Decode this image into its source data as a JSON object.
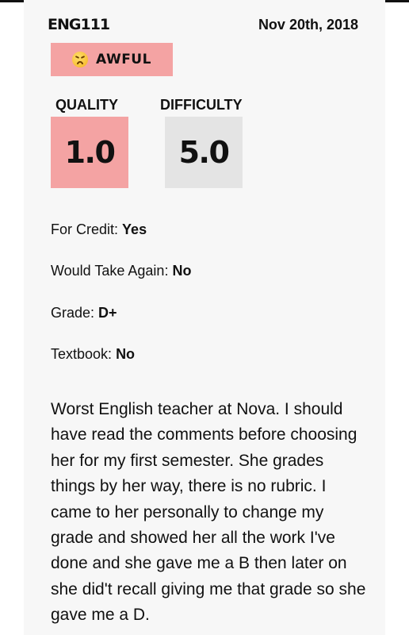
{
  "course": "ENG111",
  "date": "Nov 20th, 2018",
  "rating_tag": {
    "label": "AWFUL",
    "icon": "confounded-face-emoji",
    "color": "#f4a3a3"
  },
  "quality": {
    "label": "QUALITY",
    "value": "1.0",
    "color": "#f4a3a3"
  },
  "difficulty": {
    "label": "DIFFICULTY",
    "value": "5.0",
    "color": "#e4e4e4"
  },
  "details": [
    {
      "label": "For Credit:",
      "value": "Yes"
    },
    {
      "label": "Would Take Again:",
      "value": "No"
    },
    {
      "label": "Grade:",
      "value": "D+"
    },
    {
      "label": "Textbook:",
      "value": "No"
    }
  ],
  "review": "Worst English teacher at Nova. I should have read the comments before choosing her for my first semester. She grades things by her way, there is no rubric. I came to her personally to change my grade and showed her all the work I've done and she gave me a B then later on she did't recall giving me that grade so she gave me a D."
}
